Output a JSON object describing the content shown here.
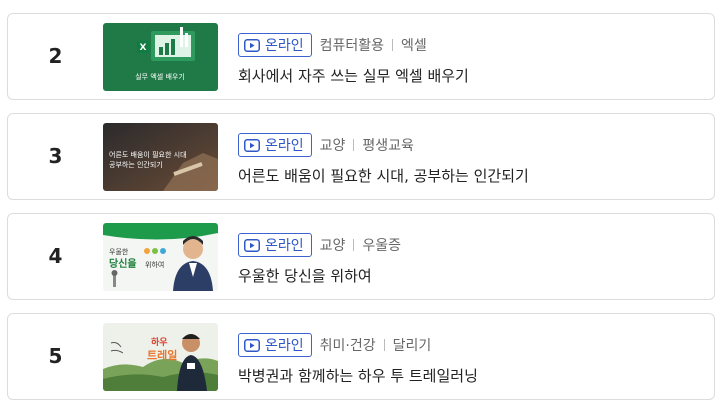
{
  "courses": [
    {
      "rank": "2",
      "badge": "온라인",
      "category": "컴퓨터활용",
      "subcategory": "엑셀",
      "title": "회사에서 자주 쓰는 실무 엑셀 배우기",
      "thumb_text": "실무 엑셀 배우기",
      "thumb_color": "#1f7a47"
    },
    {
      "rank": "3",
      "badge": "온라인",
      "category": "교양",
      "subcategory": "평생교육",
      "title": "어른도 배움이 필요한 시대, 공부하는 인간되기",
      "thumb_line1": "어른도 배움이 필요한 시대",
      "thumb_line2": "공부하는 인간되기",
      "thumb_color": "#3a3430"
    },
    {
      "rank": "4",
      "badge": "온라인",
      "category": "교양",
      "subcategory": "우울증",
      "title": "우울한 당신을 위하여",
      "thumb_line1": "우울한",
      "thumb_line2": "당신을",
      "thumb_line3": "위하여",
      "thumb_color": "#1e9b4a"
    },
    {
      "rank": "5",
      "badge": "온라인",
      "category": "취미·건강",
      "subcategory": "달리기",
      "title": "박병권과 함께하는 하우 투 트레일러닝",
      "thumb_color": "#7aa35a"
    }
  ],
  "colors": {
    "badge_blue": "#2f57c8",
    "border": "#dcdcdc"
  }
}
